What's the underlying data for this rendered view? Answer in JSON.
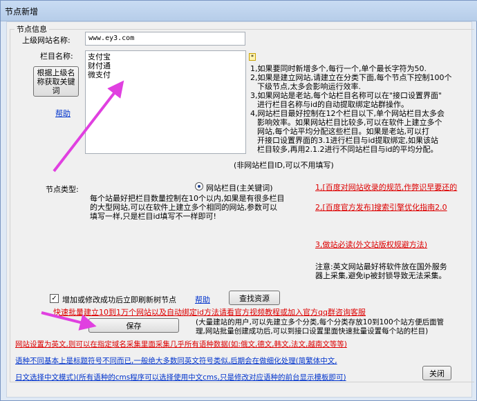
{
  "window": {
    "title": "节点新增"
  },
  "group": {
    "legend": "节点信息"
  },
  "parent_site": {
    "label": "上级网站名称:",
    "value": "www.ey3.com"
  },
  "column": {
    "label": "栏目名称:",
    "lines": [
      "支付宝",
      "财付通",
      "微支付"
    ],
    "fetch_button": "根据上级名称获取关键词",
    "help_link": "帮助",
    "star": "*"
  },
  "tips": {
    "lines": [
      "1,如果要同时新增多个,每行一个,单个最长字符为50.",
      "2,如果是建立网站,请建立在分类下面,每个节点下控制100个",
      "下级节点,太多会影响运行效率.",
      "3,如果网站是老站,每个站栏目名称可以在\"接口设置界面\"",
      "进行栏目名称与id的自动提取绑定站群操作。",
      "4,网站栏目最好控制在12个栏目以下,单个网站栏目太多会",
      "影响效率。如果网站栏目比较多,可以在软件上建立多个",
      "网站,每个站平均分配这些栏目。如果是老站,可以打",
      "开接口设置界面的3.1进行栏目与id提取绑定,如果该站",
      "栏目较多,再用2.1.2进行不同站栏目与id的平均分配。"
    ],
    "footer": "(非网站栏目ID,可以不用填写)"
  },
  "node_type": {
    "label": "节点类型:",
    "radio_label": "网站栏目(主关键词)",
    "description": [
      "每个站最好把栏目数量控制在10个以内,如果是有很多栏目",
      "的大型网站,可以在软件上建立多个相同的网站,参数可以",
      "填写一样,只是栏目id填写不一样即可!"
    ]
  },
  "side_links": [
    "1,[百度对网站收录的规范,作弊识早要还的",
    "2,[百度官方发布]搜索引擎优化指南2.0",
    "3,做站必读(外文站版权规避方法)"
  ],
  "english_note": [
    "注意:英文网站最好将软件放在国外服务",
    "器上采集,避免ip被封锁导致无法采集。"
  ],
  "refresh": {
    "checkbox_label": "增加或修改成功后立即刷新树节点",
    "checked": true,
    "help_link": "帮助",
    "find_button": "查找资源"
  },
  "promo_link": "快速批量建立10到1万个网站以及自动绑定id方法请看官方视频教程或加入官方qq群咨询客服",
  "save": {
    "button": "保存",
    "note": [
      "(大量建站的用户,可以先建立多个分类,每个分类存放10到100个站方便后面管",
      "理,网站批量创建成功后,可以到接口设置里面快速批量设置每个站的栏目)"
    ]
  },
  "footer_links": {
    "red": "网站设置为英文,则可以在指定域名采集里面采集几乎所有语种数据(如:俄文,德文,韩文,法文,越南文等等)",
    "blue1": "语种不同基本上是标题符号不同而已,一般绝大多数同英文符号类似,后期会在做细化处理(简繁体中文,",
    "blue2": "日文选择中文模式)(所有语种的cms程序可以选择使用中文cms,只是修改对应语种的前台显示模板即可)"
  },
  "close_button": "关闭",
  "colors": {
    "accent_red": "#dd0000",
    "link_blue": "#0033cc",
    "arrow_magenta": "#e040e0"
  }
}
